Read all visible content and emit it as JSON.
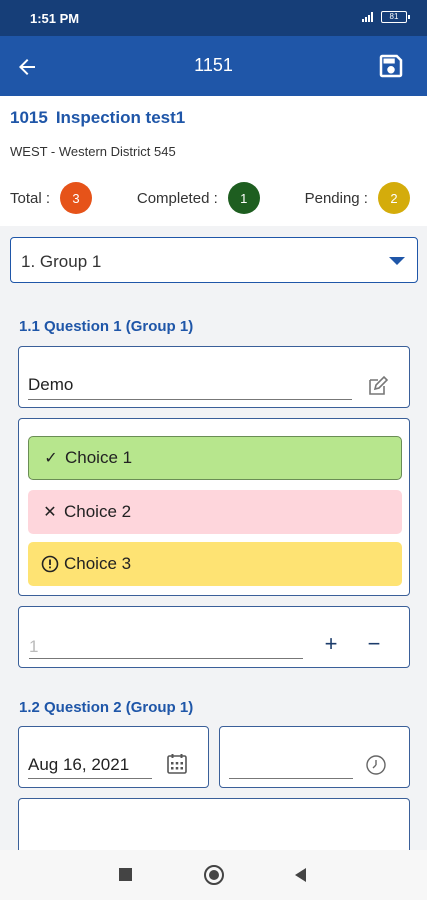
{
  "status_bar": {
    "time": "1:51 PM",
    "battery": "81"
  },
  "app_bar": {
    "title": "1151",
    "back_icon": "arrow-left-icon",
    "save_icon": "floppy-disk-icon"
  },
  "inspection": {
    "id": "1015",
    "name": "Inspection test1",
    "district": "WEST - Western District 545",
    "counts": [
      {
        "label": "Total :",
        "value": "3",
        "color": "#e65319"
      },
      {
        "label": "Completed :",
        "value": "1",
        "color": "#1e5e20"
      },
      {
        "label": "Pending :",
        "value": "2",
        "color": "#d4ac0b"
      }
    ]
  },
  "group_select": {
    "selected": "1. Group 1",
    "icon": "caret-down-icon"
  },
  "question1": {
    "title": "1.1 Question 1 (Group 1)",
    "text_value": "Demo",
    "choices": [
      {
        "label": "Choice 1",
        "mark": "✓",
        "icon": "check-icon",
        "color": "#b7e68d"
      },
      {
        "label": "Choice 2",
        "mark": "✕",
        "icon": "close-icon",
        "color": "#fed6dc"
      },
      {
        "label": "Choice 3",
        "mark": "!",
        "icon": "alert-circle-icon",
        "color": "#fee373"
      }
    ],
    "number_placeholder": "1",
    "plus": "+",
    "minus": "−"
  },
  "question2": {
    "title": "1.2 Question 2 (Group 1)",
    "date_value": "Aug 16, 2021",
    "time_value": ""
  }
}
